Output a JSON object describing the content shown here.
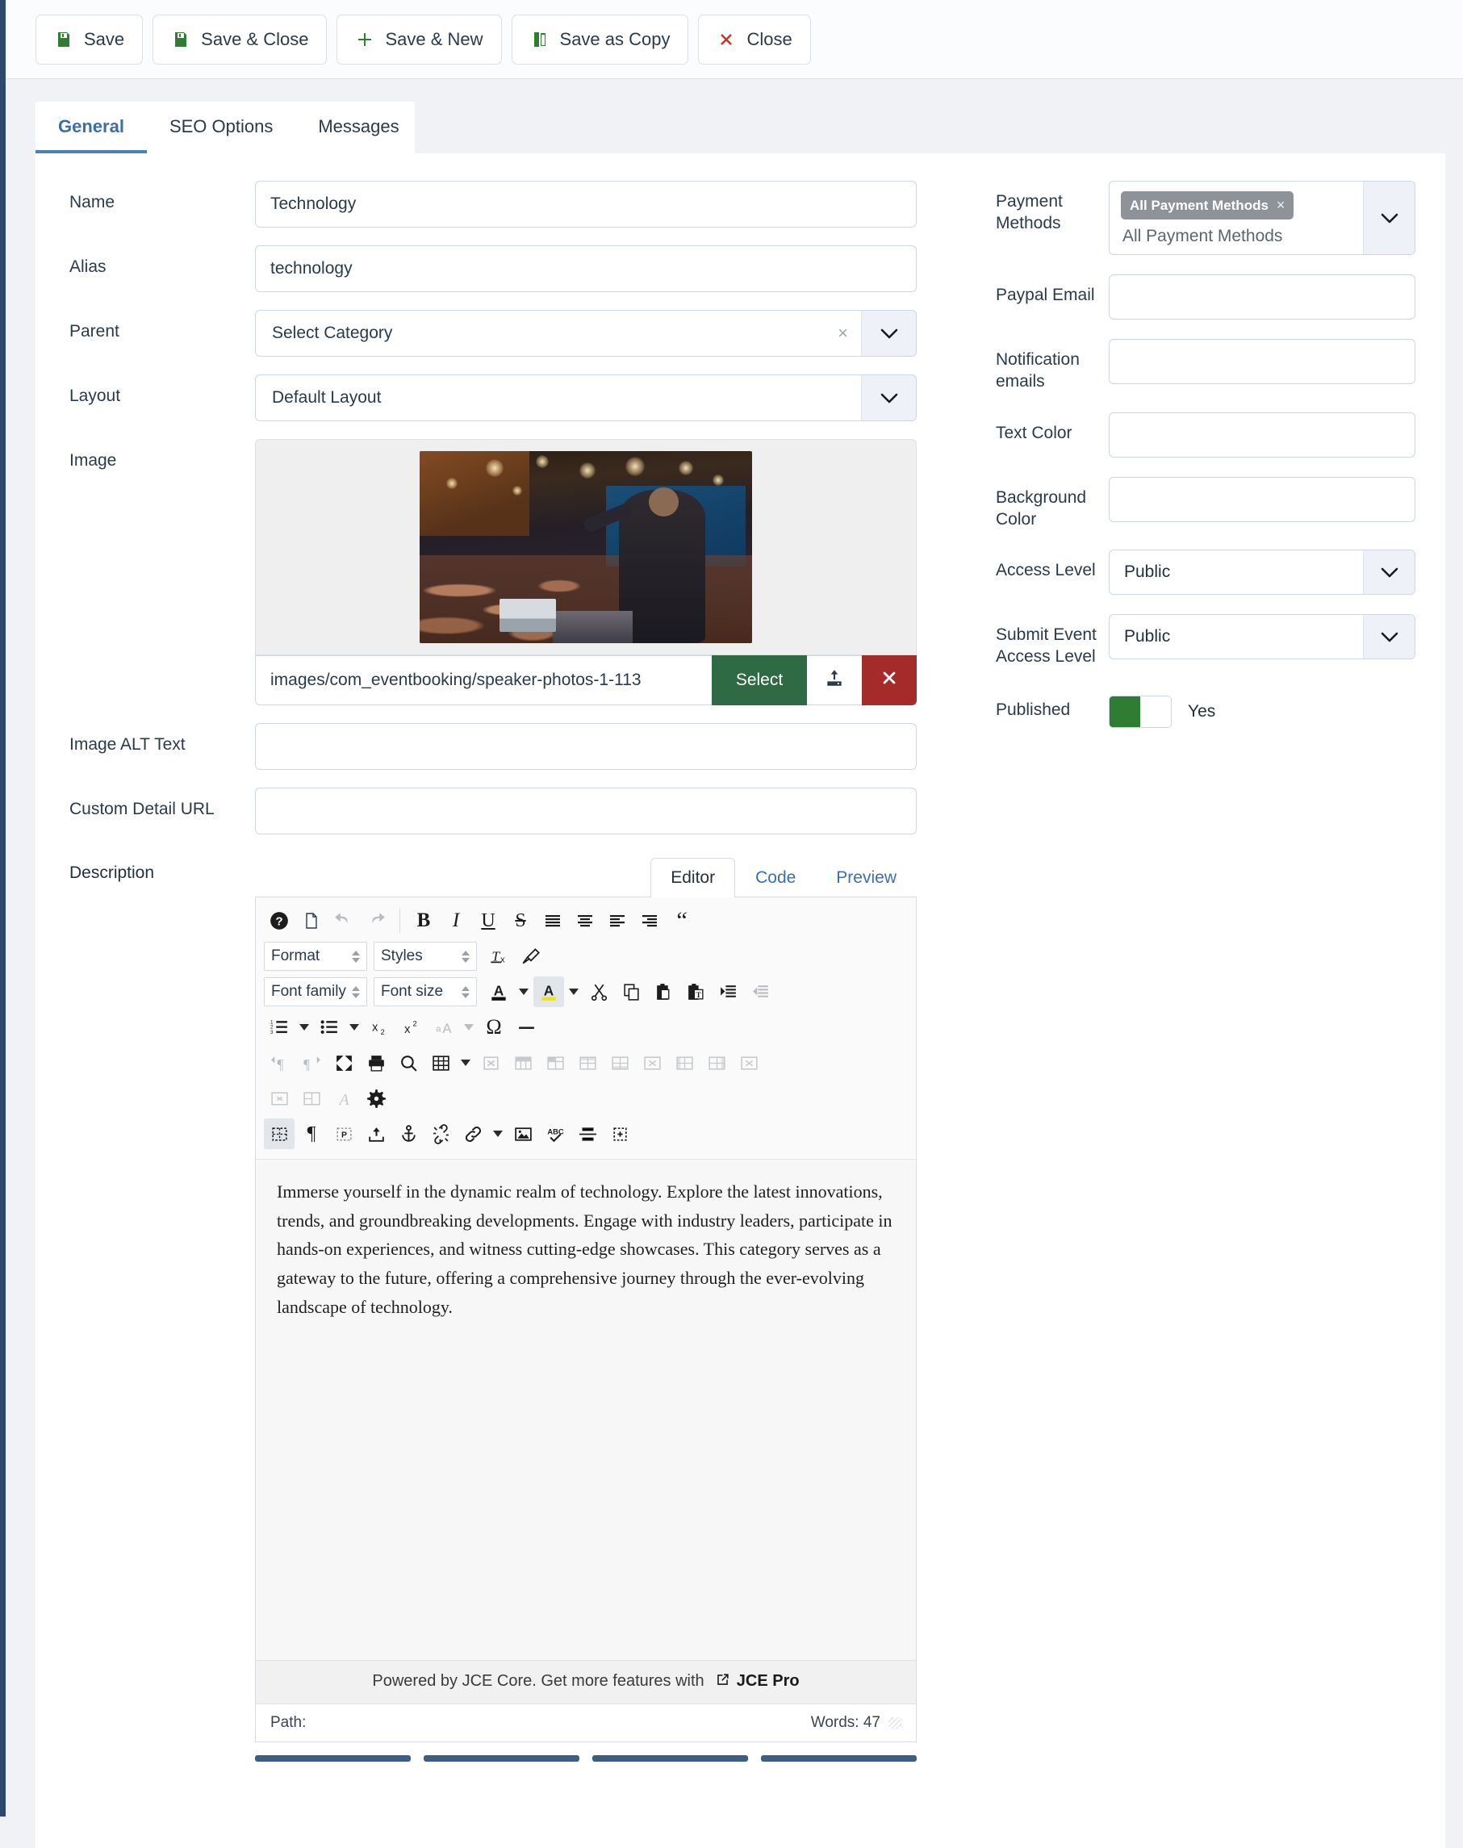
{
  "toolbar": {
    "buttons": [
      {
        "label": "Save",
        "icon": "save-icon"
      },
      {
        "label": "Save & Close",
        "icon": "save-close-icon"
      },
      {
        "label": "Save & New",
        "icon": "plus-icon"
      },
      {
        "label": "Save as Copy",
        "icon": "copy-icon"
      },
      {
        "label": "Close",
        "icon": "x-icon"
      }
    ]
  },
  "tabs": [
    {
      "label": "General",
      "active": true
    },
    {
      "label": "SEO Options",
      "active": false
    },
    {
      "label": "Messages",
      "active": false
    }
  ],
  "form": {
    "name": {
      "label": "Name",
      "value": "Technology"
    },
    "alias": {
      "label": "Alias",
      "value": "technology"
    },
    "parent": {
      "label": "Parent",
      "value": "Select Category",
      "clear_icon": "x-icon",
      "chevron": "chevron-down-icon"
    },
    "layout": {
      "label": "Layout",
      "value": "Default Layout",
      "chevron": "chevron-down-icon"
    },
    "image": {
      "label": "Image",
      "path": "images/com_eventbooking/speaker-photos-1-113",
      "select_label": "Select",
      "upload_icon": "upload-icon",
      "delete_icon": "x-icon"
    },
    "image_alt": {
      "label": "Image ALT Text",
      "value": ""
    },
    "custom_detail_url": {
      "label": "Custom Detail URL",
      "value": ""
    },
    "description": {
      "label": "Description"
    }
  },
  "right": {
    "payment_methods": {
      "label": "Payment Methods",
      "chip": "All Payment Methods",
      "chip_remove": "×",
      "text": "All Payment Methods",
      "chevron": "chevron-down-icon"
    },
    "paypal_email": {
      "label": "Paypal Email",
      "value": ""
    },
    "notification_emails": {
      "label": "Notification emails",
      "value": ""
    },
    "text_color": {
      "label": "Text Color",
      "value": ""
    },
    "background_color": {
      "label": "Background Color",
      "value": ""
    },
    "access_level": {
      "label": "Access Level",
      "value": "Public",
      "chevron": "chevron-down-icon"
    },
    "submit_event_access_level": {
      "label": "Submit Event Access Level",
      "value": "Public",
      "chevron": "chevron-down-icon"
    },
    "published": {
      "label": "Published",
      "state": "Yes",
      "on_color": "#2e7d32"
    }
  },
  "editor": {
    "tabs": [
      {
        "label": "Editor",
        "active": true
      },
      {
        "label": "Code",
        "active": false
      },
      {
        "label": "Preview",
        "active": false
      }
    ],
    "selects": {
      "format": "Format",
      "styles": "Styles",
      "font_family": "Font family",
      "font_size": "Font size"
    },
    "content": "Immerse yourself in the dynamic realm of technology. Explore the latest innovations, trends, and groundbreaking developments. Engage with industry leaders, participate in hands-on experiences, and witness cutting-edge showcases. This category serves as a gateway to the future, offering a comprehensive journey through the ever-evolving landscape of technology.",
    "status_prefix": "Powered by JCE Core. Get more features with",
    "status_link": "JCE Pro",
    "status_link_icon": "external-link-icon",
    "path_label": "Path:",
    "words_label": "Words: 47"
  },
  "colors": {
    "accent_blue": "#4a7fbb",
    "save_green": "#2e6b45",
    "delete_red": "#a52a2a",
    "toggle_green": "#2e7d32",
    "sidebar_navy": "#2d4a6d"
  }
}
